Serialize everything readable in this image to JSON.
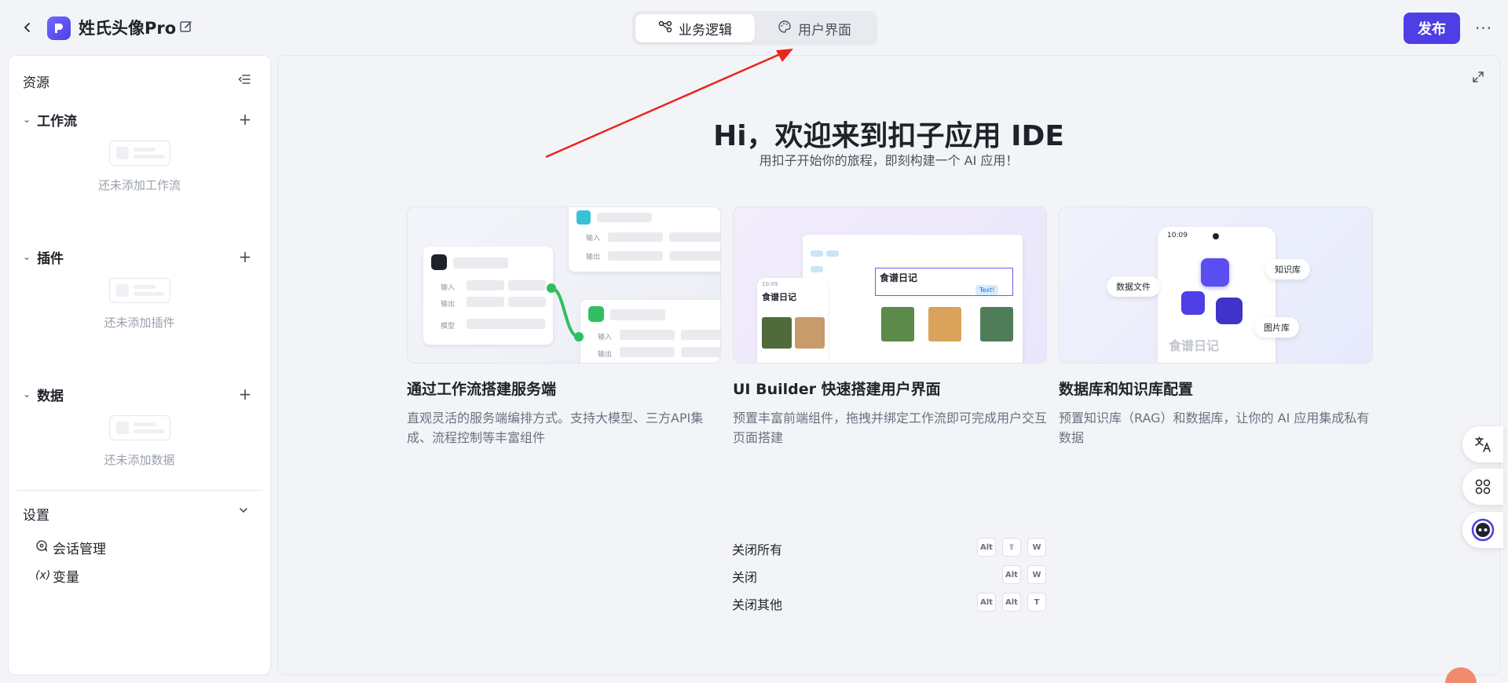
{
  "header": {
    "app_title": "姓氏头像Pro",
    "mode_tabs": [
      {
        "label": "业务逻辑",
        "active": true
      },
      {
        "label": "用户界面",
        "active": false
      }
    ],
    "publish_label": "发布",
    "more_label": "···"
  },
  "sidebar": {
    "title": "资源",
    "sections": [
      {
        "label": "工作流",
        "empty_text": "还未添加工作流"
      },
      {
        "label": "插件",
        "empty_text": "还未添加插件"
      },
      {
        "label": "数据",
        "empty_text": "还未添加数据"
      }
    ],
    "settings": {
      "title": "设置",
      "items": [
        {
          "label": "会话管理"
        },
        {
          "label": "变量",
          "icon_text": "(x)"
        }
      ]
    }
  },
  "main": {
    "hero_title": "Hi，欢迎来到扣子应用 IDE",
    "hero_sub": "用扣子开始你的旅程，即刻构建一个 AI 应用！",
    "cards": [
      {
        "title": "通过工作流搭建服务端",
        "desc": "直观灵活的服务端编排方式。支持大模型、三方API集成、流程控制等丰富组件",
        "illus": {
          "in": "输入",
          "out": "输出",
          "model": "模型"
        }
      },
      {
        "title": "UI Builder 快速搭建用户界面",
        "desc": "预置丰富前端组件，拖拽并绑定工作流即可完成用户交互页面搭建",
        "illus": {
          "heading": "食谱日记",
          "text_tag": "Text!",
          "time": "10:09"
        }
      },
      {
        "title": "数据库和知识库配置",
        "desc": "预置知识库（RAG）和数据库，让你的 AI 应用集成私有数据",
        "illus": {
          "chip_data": "数据文件",
          "chip_kb": "知识库",
          "chip_img": "图片库",
          "caption": "食谱日记",
          "time": "10:09"
        }
      }
    ],
    "shortcuts": [
      {
        "label": "关闭所有",
        "keys": [
          "Alt",
          "⇧",
          "W"
        ]
      },
      {
        "label": "关闭",
        "keys": [
          "Alt",
          "W"
        ]
      },
      {
        "label": "关闭其他",
        "keys": [
          "Alt",
          "Alt",
          "T"
        ]
      }
    ]
  },
  "colors": {
    "brand": "#4d3ee6",
    "annotation_arrow": "#e8261c",
    "flow_green": "#2fbf60"
  }
}
